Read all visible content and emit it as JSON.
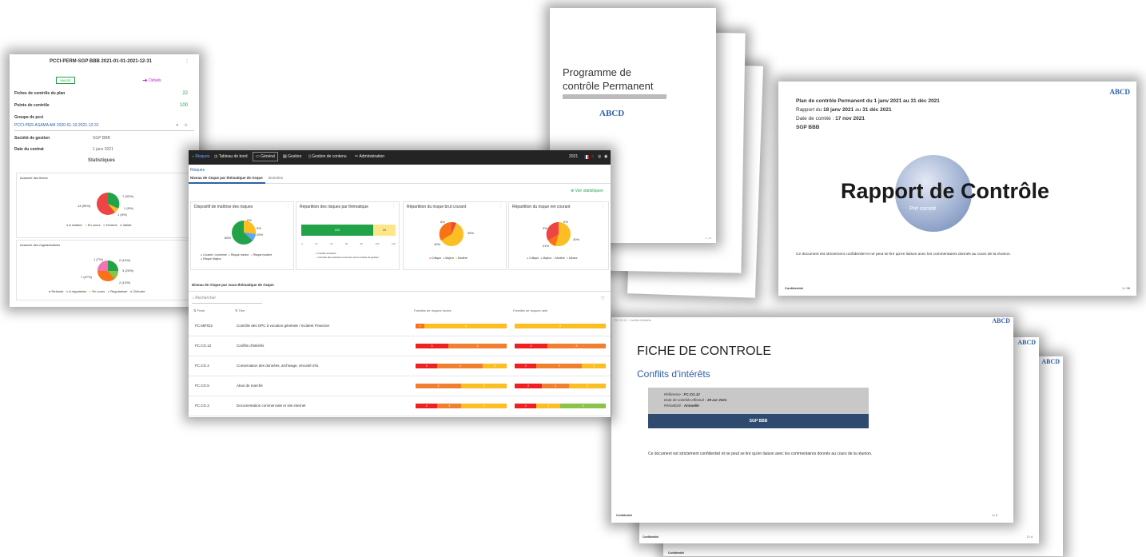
{
  "colors": {
    "green": "#22c55e",
    "red": "#ef4444",
    "orange": "#f97316",
    "yellow": "#fbbf24",
    "pink": "#f472b6",
    "blue": "#60a5fa",
    "magenta": "#c026d3",
    "navy": "#2e4a6f"
  },
  "panel_plan": {
    "title": "PCCI-PERM-SGP BBB 2021-01-01-2021-12-31",
    "status_badge": "VALIDÉ",
    "details_link": "Détails",
    "rows": [
      {
        "label": "Fiches de contrôle du plan",
        "value": "22"
      },
      {
        "label": "Points de contrôle",
        "value": "100"
      }
    ],
    "group_label": "Groupe de pcci",
    "group_value": "PCCI-PER-ASAMA AM 2020-01-10-2021-12-31",
    "company_label": "Société de gestion",
    "company_value": "SGP BBB",
    "date_label": "Date du contrat",
    "date_value": "1 janv 2021",
    "stats_title": "Statistiques",
    "chart1_title": "Avancée des fiches",
    "chart1_labels": [
      "7 (32%)",
      "1 (5%)",
      "1 (5%)",
      "13 (59%)"
    ],
    "chart1_legend": [
      "A réaliser",
      "En cours",
      "Terminé",
      "Validé"
    ],
    "chart2_title": "Avancée des régularisations",
    "chart2_labels": [
      "1 (7%)",
      "2 (13%)",
      "3 (20%)",
      "7 (47%)",
      "2 (13%)"
    ],
    "chart2_legend": [
      "Refusée",
      "A régulariser",
      "En cours",
      "Régularisée",
      "Clôturée"
    ]
  },
  "app": {
    "nav": [
      "Risques",
      "Tableau de bord",
      "Général",
      "Gestion",
      "Gestion de contenu",
      "Administration"
    ],
    "year": "2021",
    "breadcrumb": "Risques",
    "tabs": [
      "Niveau de risque par thématique de risque",
      "Données"
    ],
    "stats_link": "Voir statistiques",
    "cards": [
      {
        "title": "Dispositif de maîtrise des risques",
        "labels": [
          "65%",
          "0%",
          "9%",
          "25%"
        ],
        "legend": [
          "Couvert / conforme",
          "Risque mineur",
          "Risque modéré",
          "Risque Majeur"
        ]
      },
      {
        "title": "Répartition des risques par thématique",
        "bar_values": [
          "102",
          "26"
        ],
        "axis": [
          "0",
          "20",
          "40",
          "60",
          "80",
          "100",
          "120"
        ],
        "legend": [
          "Conflits d'intérêts",
          "Contrôle des activités et services de la société de gestion"
        ]
      },
      {
        "title": "Répartition du risque brut courant",
        "labels": [
          "6%",
          "40%",
          "45%"
        ],
        "legend": [
          "Critique",
          "Majeur",
          "Modéré"
        ]
      },
      {
        "title": "Répartition du risque net courant",
        "labels": [
          "0%",
          "21%",
          "40%",
          "3%"
        ],
        "legend": [
          "Critique",
          "Majeur",
          "Modéré",
          "Mineur"
        ]
      }
    ],
    "section_title": "Niveau de risque par sous-thématique de risque",
    "search_placeholder": "Rechercher",
    "col_fiche": "Fiche",
    "col_titre": "Titre",
    "col_brut": "Familles de risques brutes",
    "col_net": "Familles de risques nets",
    "rows": [
      {
        "fiche": "FC.MIFID2",
        "title": "Contrôle des OPC à vocation générale / Incident Financier",
        "brut": [
          [
            "#f97316",
            10,
            "1"
          ],
          [
            "#fbbf24",
            90,
            "4"
          ]
        ],
        "net": [
          [
            "#fbbf24",
            100,
            "5"
          ]
        ]
      },
      {
        "fiche": "FC.CG.12",
        "title": "Conflits d'intérêts",
        "brut": [
          [
            "#ef2020",
            36,
            "3"
          ],
          [
            "#f08030",
            64,
            "3"
          ]
        ],
        "net": [
          [
            "#ef2020",
            36,
            "2"
          ],
          [
            "#f08030",
            64,
            "3"
          ]
        ]
      },
      {
        "fiche": "FC.CG.4",
        "title": "Conservation des données, archivage, sécurité info.",
        "brut": [
          [
            "#ef2020",
            24,
            "3"
          ],
          [
            "#f08030",
            50,
            "4"
          ],
          [
            "#fbbf24",
            26,
            "3"
          ]
        ],
        "net": [
          [
            "#ef2020",
            24,
            "2"
          ],
          [
            "#f08030",
            50,
            "3"
          ],
          [
            "#fbbf24",
            26,
            "3"
          ]
        ]
      },
      {
        "fiche": "FC.CG.5",
        "title": "Abus de marché",
        "brut": [
          [
            "#f08030",
            50,
            "3"
          ],
          [
            "#fbbf24",
            50,
            "3"
          ]
        ],
        "net": [
          [
            "#ef2020",
            30,
            "2"
          ],
          [
            "#f08030",
            30,
            "2"
          ],
          [
            "#fbbf24",
            40,
            "3"
          ]
        ]
      },
      {
        "fiche": "FC.CG.3",
        "title": "Documentation commerciale et site internet",
        "brut": [
          [
            "#ef2020",
            24,
            "2"
          ],
          [
            "#f08030",
            26,
            "3"
          ],
          [
            "#fbbf24",
            50,
            "4"
          ]
        ],
        "net": [
          [
            "#ef2020",
            24,
            "2"
          ],
          [
            "#fbbf24",
            26,
            "1"
          ],
          [
            "#8bc34a",
            50,
            "3"
          ]
        ]
      }
    ]
  },
  "doc_programme": {
    "title": "Programme de contrôle Permanent",
    "logo": "ABCD",
    "footer_page": "1 / 28"
  },
  "doc_rapport": {
    "logo": "ABCD",
    "line1": "Plan de contrôle Permanent du 1 janv 2021 au 31 déc 2021",
    "line2_pre": "Rapport du ",
    "line2_a": "18 janv 2021",
    "line2_mid": " au ",
    "line2_b": "31 déc 2021",
    "line3_pre": "Date de comité : ",
    "line3_b": "17 nov 2021",
    "line4": "SGP BBB",
    "title": "Rapport de Contrôle",
    "subtitle": "Pré comité",
    "disclaimer": "Ce document est strictement confidentiel et ne peut se lire qu'en liaison avec les commentaires donnés au cours de la réunion.",
    "footer_left": "Confidentiel",
    "footer_right": "1 / 28"
  },
  "doc_fiche": {
    "header_left": "FC.CG.12 - Conflits d'intérêts",
    "logo": "ABCD",
    "title": "FICHE DE CONTROLE",
    "subtitle": "Conflits d'intérêts",
    "ref_label": "Référence : ",
    "ref_value": "FC.CG.12",
    "date_label": "Date de contrôle effectué : ",
    "date_value": "29 avr 2021",
    "period_label": "Périodicité : ",
    "period_value": "Annuelle",
    "company": "SGP BBB",
    "disclaimer": "Ce document est strictement confidentiel et ne peut se lire qu'en liaison avec les commentaires donnés au cours de la réunion.",
    "footer_left": "Confidentiel",
    "footer_right": "1 / 4",
    "back_footer_left": "Confidentiel",
    "back_footer_right": "2 / 4",
    "back2_footer_left": "Confidentiel"
  }
}
